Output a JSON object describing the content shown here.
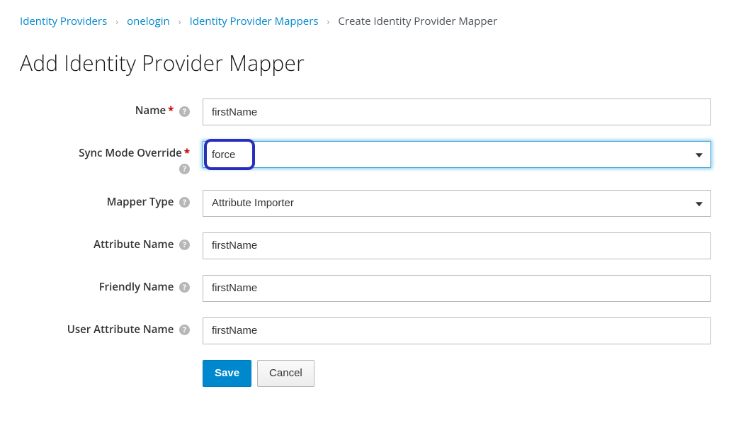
{
  "breadcrumb": {
    "items": [
      {
        "label": "Identity Providers",
        "link": true
      },
      {
        "label": "onelogin",
        "link": true
      },
      {
        "label": "Identity Provider Mappers",
        "link": true
      },
      {
        "label": "Create Identity Provider Mapper",
        "link": false
      }
    ]
  },
  "page": {
    "title": "Add Identity Provider Mapper"
  },
  "form": {
    "name": {
      "label": "Name",
      "value": "firstName",
      "required": true
    },
    "syncMode": {
      "label": "Sync Mode Override",
      "value": "force",
      "required": true
    },
    "mapperType": {
      "label": "Mapper Type",
      "value": "Attribute Importer",
      "required": false
    },
    "attributeName": {
      "label": "Attribute Name",
      "value": "firstName",
      "required": false
    },
    "friendlyName": {
      "label": "Friendly Name",
      "value": "firstName",
      "required": false
    },
    "userAttributeName": {
      "label": "User Attribute Name",
      "value": "firstName",
      "required": false
    }
  },
  "buttons": {
    "save": "Save",
    "cancel": "Cancel"
  }
}
